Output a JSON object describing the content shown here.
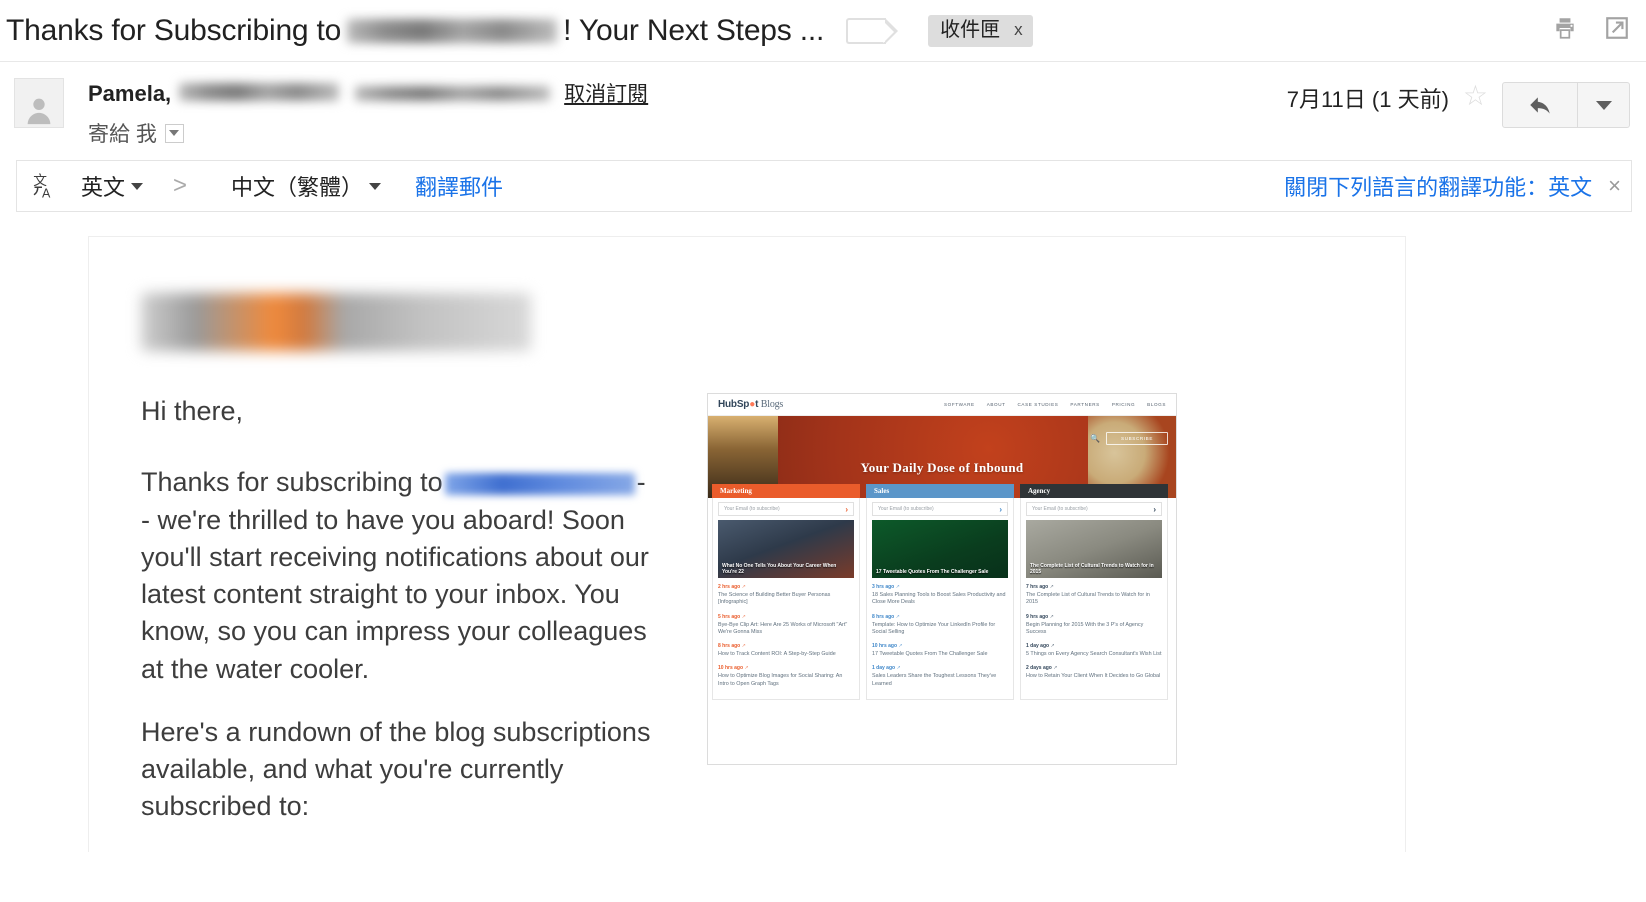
{
  "subject": {
    "prefix": "Thanks for Subscribing to",
    "suffix": "! Your Next Steps ...",
    "label_chip": "收件匣",
    "label_chip_close": "x",
    "print_icon": "print-icon",
    "popout_icon": "open-in-new-window-icon"
  },
  "sender": {
    "name": "Pamela,",
    "unsubscribe": "取消訂閱",
    "to_line": "寄給 我",
    "date": "7月11日 (1 天前)",
    "star_icon": "star-outline-icon",
    "reply_icon": "reply-arrow-icon",
    "more_icon": "chevron-down-icon",
    "avatar_icon": "person-avatar-icon"
  },
  "translate": {
    "icon": "translate-icon",
    "source_lang": "英文",
    "arrow": ">",
    "target_lang": "中文（繁體）",
    "action": "翻譯郵件",
    "turn_off": "關閉下列語言的翻譯功能：英文",
    "close": "×",
    "link_color": "#1a73e8"
  },
  "email_body": {
    "greeting": "Hi there,",
    "p1_before": "Thanks for subscribing to",
    "p1_after": "- - we're thrilled to have you aboard! Soon you'll start receiving notifications about our latest content straight to your inbox. You know, so you can impress your colleagues at the water cooler.",
    "p2": "Here's a rundown of the blog subscriptions available, and what you're currently subscribed to:"
  },
  "embedded_screenshot": {
    "site_name": "HubSpot Blogs",
    "nav": [
      "SOFTWARE",
      "ABOUT",
      "CASE STUDIES",
      "PARTNERS",
      "PRICING",
      "BLOGS"
    ],
    "hero_title": "Your Daily Dose of Inbound",
    "subscribe_button": "SUBSCRIBE",
    "search_icon": "search-icon",
    "columns": [
      {
        "tab": "Marketing",
        "tab_color": "#ea5c2b",
        "email_placeholder": "Your Email (to subscribe)",
        "featured": "What No One Tells You About Your Career When You're 22",
        "articles": [
          {
            "time": "2 hrs ago",
            "title": "The Science of Building Better Buyer Personas [Infographic]"
          },
          {
            "time": "5 hrs ago",
            "title": "Bye-Bye Clip Art: Here Are 25 Works of Microsoft \"Art\" We're Gonna Miss"
          },
          {
            "time": "8 hrs ago",
            "title": "How to Track Content ROI: A Step-by-Step Guide"
          },
          {
            "time": "10 hrs ago",
            "title": "How to Optimize Blog Images for Social Sharing: An Intro to Open Graph Tags"
          }
        ]
      },
      {
        "tab": "Sales",
        "tab_color": "#5b96c9",
        "email_placeholder": "Your Email (to subscribe)",
        "featured": "17 Tweetable Quotes From The Challenger Sale",
        "articles": [
          {
            "time": "3 hrs ago",
            "title": "18 Sales Planning Tools to Boost Sales Productivity and Close More Deals"
          },
          {
            "time": "8 hrs ago",
            "title": "Template: How to Optimize Your LinkedIn Profile for Social Selling"
          },
          {
            "time": "10 hrs ago",
            "title": "17 Tweetable Quotes From The Challenger Sale"
          },
          {
            "time": "1 day ago",
            "title": "Sales Leaders Share the Toughest Lessons They've Learned"
          }
        ]
      },
      {
        "tab": "Agency",
        "tab_color": "#2f3437",
        "email_placeholder": "Your Email (to subscribe)",
        "featured": "The Complete List of Cultural Trends to Watch for in 2015",
        "articles": [
          {
            "time": "7 hrs ago",
            "title": "The Complete List of Cultural Trends to Watch for in 2015"
          },
          {
            "time": "9 hrs ago",
            "title": "Begin Planning for 2015 With the 3 P's of Agency Success"
          },
          {
            "time": "1 day ago",
            "title": "5 Things on Every Agency Search Consultant's Wish List"
          },
          {
            "time": "2 days ago",
            "title": "How to Retain Your Client When It Decides to Go Global"
          }
        ]
      }
    ]
  }
}
